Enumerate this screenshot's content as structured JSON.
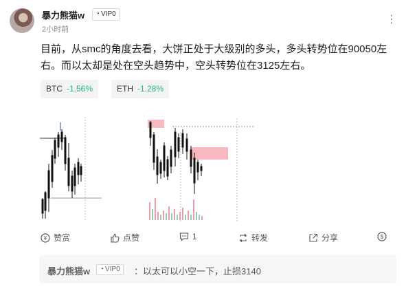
{
  "post": {
    "username": "暴力熊猫w",
    "vip_label": "VIP0",
    "time": "2小时前",
    "text": "目前，从smc的角度去看，大饼正处于大级别的多头，多头转势位在90050左右。而以太却是处在空头趋势中，空头转势位在3125左右。"
  },
  "tags": [
    {
      "symbol": "BTC",
      "change": "-1.56%"
    },
    {
      "symbol": "ETH",
      "change": "-1.28%"
    }
  ],
  "actions": {
    "appreciate": "赞赏",
    "like": "点赞",
    "comment": "1",
    "repost": "转发",
    "share": "分享"
  },
  "comment": {
    "username": "暴力熊猫w",
    "vip_label": "VIP0",
    "text": "：以太可以小空一下，止损3140"
  },
  "colors": {
    "up": "#1fb97a",
    "candle": "#111111",
    "zone": "#f7b8bf",
    "volume_red": "#ef9aa5",
    "volume_green": "#8bd3b0"
  }
}
